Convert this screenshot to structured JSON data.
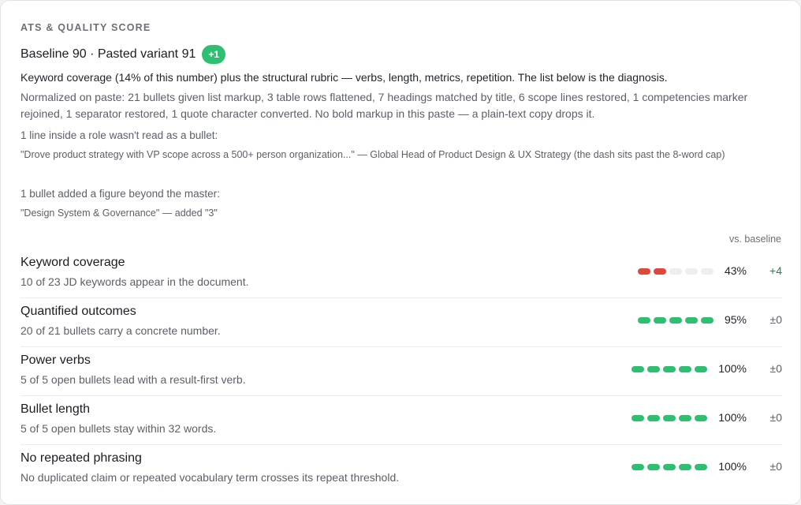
{
  "section_title": "ATS & QUALITY SCORE",
  "headline": {
    "text": "Baseline 90 · Pasted variant 91",
    "delta": "+1",
    "delta_color": "#2fbf71"
  },
  "summary": "Keyword coverage (14% of this number) plus the structural rubric — verbs, length, metrics, repetition. The list below is the diagnosis.",
  "normalized": "Normalized on paste: 21 bullets given list markup, 3 table rows flattened, 7 headings matched by title, 6 scope lines restored, 1 competencies marker rejoined, 1 separator restored, 1 quote character converted. No bold markup in this paste — a plain-text copy drops it.",
  "notes": [
    {
      "label": "1 line inside a role wasn't read as a bullet:",
      "quote": "\"Drove product strategy with VP scope across a 500+ person organization...\" — Global Head of Product Design & UX Strategy (the dash sits past the 8-word cap)"
    },
    {
      "label": "1 bullet added a figure beyond the master:",
      "quote": "\"Design System & Governance\" — added \"3\""
    }
  ],
  "vs_baseline_label": "vs. baseline",
  "colors": {
    "good": "#2fbf71",
    "bad": "#e0483e",
    "empty": "#eeeeee",
    "positive_delta": "#1a8a4a"
  },
  "metrics": [
    {
      "name": "Keyword coverage",
      "description": "10 of 23 JD keywords appear in the document.",
      "percent": "43%",
      "level": 2,
      "level_max": 5,
      "status": "bad",
      "delta": "+4",
      "delta_positive": true
    },
    {
      "name": "Quantified outcomes",
      "description": "20 of 21 bullets carry a concrete number.",
      "percent": "95%",
      "level": 5,
      "level_max": 5,
      "status": "good",
      "delta": "±0",
      "delta_positive": false
    },
    {
      "name": "Power verbs",
      "description": "5 of 5 open bullets lead with a result-first verb.",
      "percent": "100%",
      "level": 5,
      "level_max": 5,
      "status": "good",
      "delta": "±0",
      "delta_positive": false
    },
    {
      "name": "Bullet length",
      "description": "5 of 5 open bullets stay within 32 words.",
      "percent": "100%",
      "level": 5,
      "level_max": 5,
      "status": "good",
      "delta": "±0",
      "delta_positive": false
    },
    {
      "name": "No repeated phrasing",
      "description": "No duplicated claim or repeated vocabulary term crosses its repeat threshold.",
      "percent": "100%",
      "level": 5,
      "level_max": 5,
      "status": "good",
      "delta": "±0",
      "delta_positive": false
    }
  ]
}
